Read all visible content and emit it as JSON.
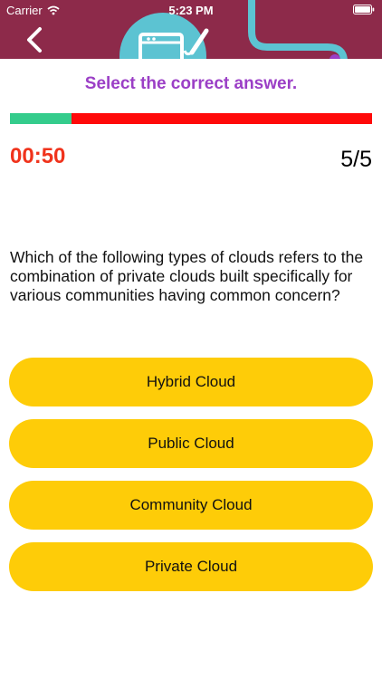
{
  "status_bar": {
    "carrier": "Carrier",
    "time": "5:23 PM"
  },
  "header": {
    "background_color": "#8d2a4a",
    "back_icon": "chevron-left-icon"
  },
  "quiz": {
    "instruction": "Select the correct answer.",
    "progress_fraction": 0.17,
    "timer": "00:50",
    "counter": "5/5",
    "question": "Which of the following types of clouds refers to the combination of private clouds built specifically for various communities having common concern?",
    "answers": [
      {
        "label": "Hybrid Cloud"
      },
      {
        "label": "Public Cloud"
      },
      {
        "label": "Community Cloud"
      },
      {
        "label": "Private Cloud"
      }
    ]
  },
  "colors": {
    "instruction": "#9b3fc6",
    "progress_done": "#34cc8c",
    "progress_remaining": "#ff0a0a",
    "timer": "#f0331c",
    "answer_button": "#fecc08"
  }
}
